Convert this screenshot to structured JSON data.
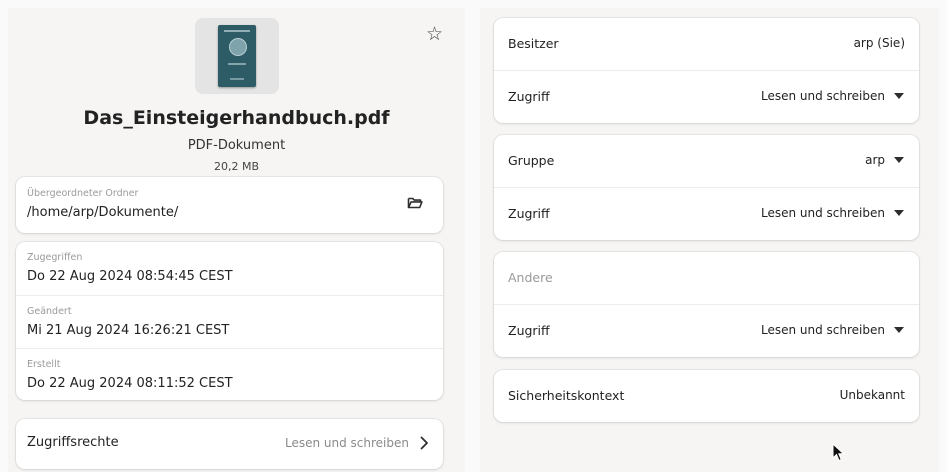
{
  "file": {
    "name": "Das_Einsteigerhandbuch.pdf",
    "type": "PDF-Dokument",
    "size": "20,2 MB",
    "starred": false
  },
  "parent_folder": {
    "label": "Übergeordneter Ordner",
    "path": "/home/arp/Dokumente/"
  },
  "dates": [
    {
      "label": "Zugegriffen",
      "value": "Do 22 Aug 2024 08:54:45 CEST"
    },
    {
      "label": "Geändert",
      "value": "Mi 21 Aug 2024 16:26:21 CEST"
    },
    {
      "label": "Erstellt",
      "value": "Do 22 Aug 2024 08:11:52 CEST"
    }
  ],
  "permissions_row": {
    "label": "Zugriffsrechte",
    "value": "Lesen und schreiben"
  },
  "owner": {
    "label": "Besitzer",
    "value": "arp (Sie)",
    "access_label": "Zugriff",
    "access_value": "Lesen und schreiben"
  },
  "group": {
    "label": "Gruppe",
    "value": "arp",
    "access_label": "Zugriff",
    "access_value": "Lesen und schreiben"
  },
  "others": {
    "label": "Andere",
    "access_label": "Zugriff",
    "access_value": "Lesen und schreiben"
  },
  "security_context": {
    "label": "Sicherheitskontext",
    "value": "Unbekannt"
  },
  "icons": {
    "star": "star-outline-icon",
    "folder": "folder-open-icon",
    "chevron": "chevron-right-icon",
    "dropdown": "caret-down-icon"
  },
  "colors": {
    "background": "#fafafa",
    "panel": "#f6f5f4",
    "card": "#ffffff",
    "thumbnail_cover": "#2d5b66",
    "dim_text": "#9a9a9a"
  }
}
